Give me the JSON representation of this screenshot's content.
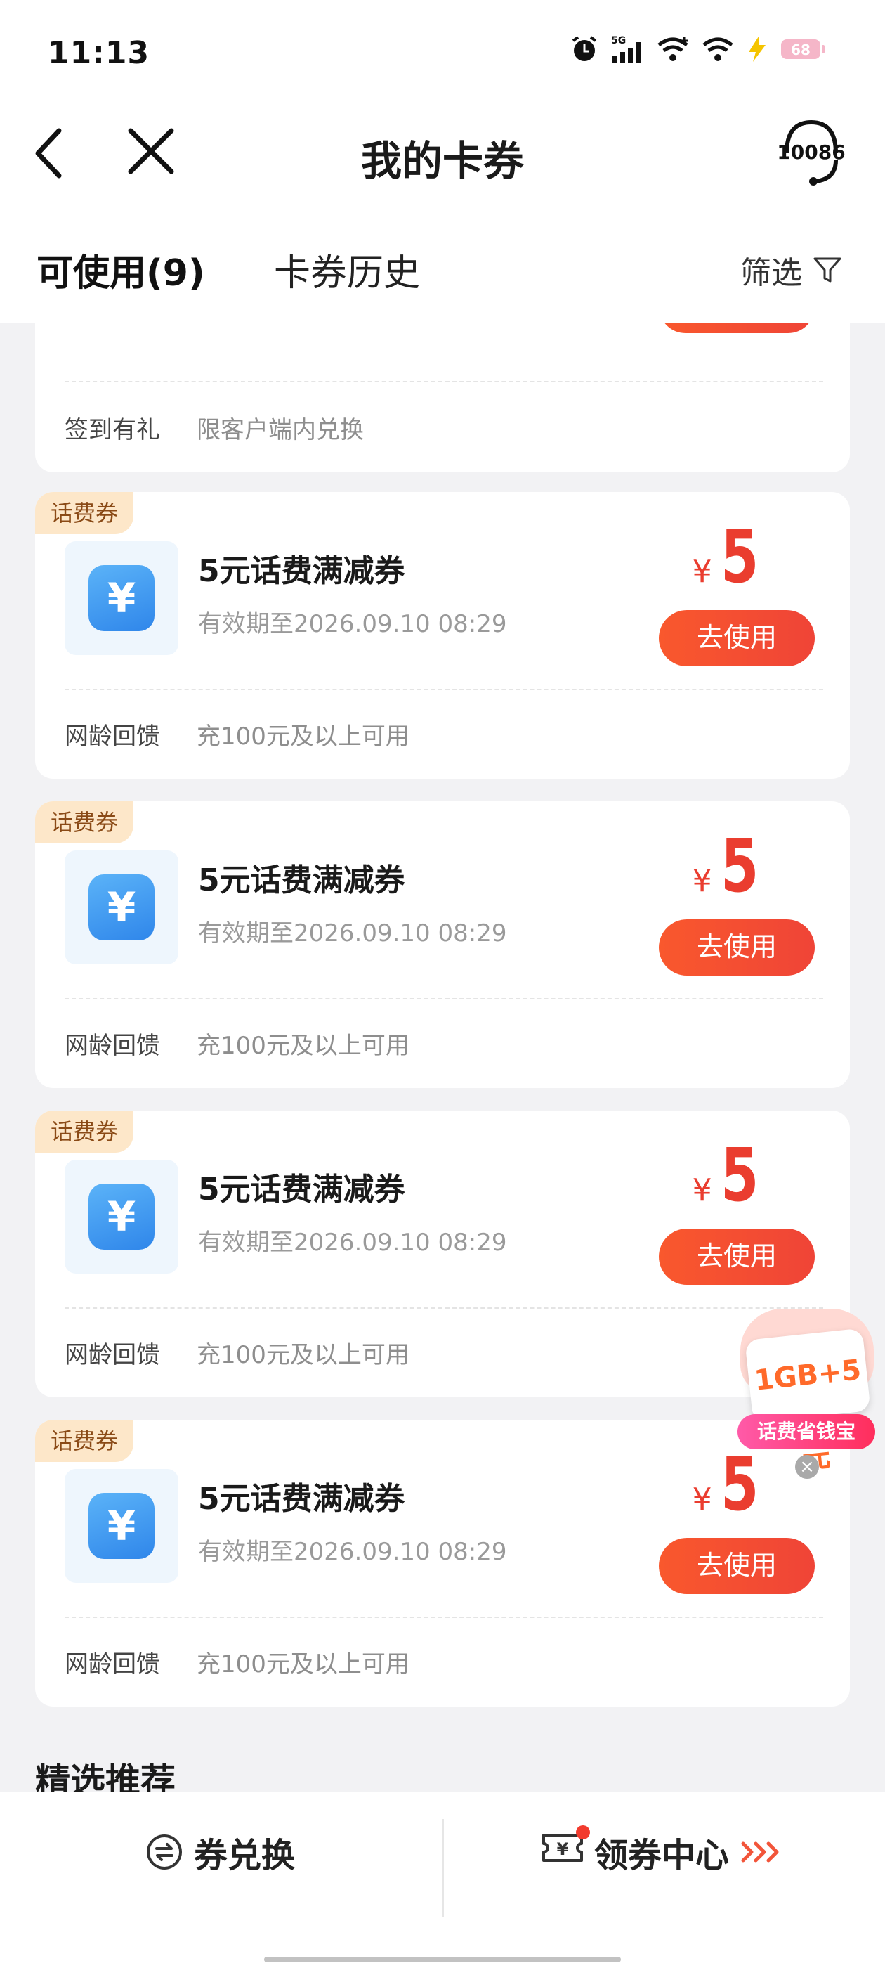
{
  "status": {
    "time": "11:13",
    "network": "5G",
    "battery": "68",
    "icons": [
      "alarm-icon",
      "signal-icon",
      "wifi-plus-icon",
      "wifi-icon",
      "charging-icon",
      "battery-icon"
    ]
  },
  "nav": {
    "title": "我的卡券",
    "service_number": "10086"
  },
  "tabs": {
    "available": "可使用(9)",
    "history": "卡券历史",
    "filter": "筛选"
  },
  "partial_card": {
    "button": "去使用",
    "footer_name": "签到有礼",
    "footer_desc": "限客户端内兑换"
  },
  "cards": [
    {
      "tag": "话费券",
      "title": "5元话费满减券",
      "validity": "有效期至2026.09.10 08:29",
      "currency": "¥",
      "amount": "5",
      "button": "去使用",
      "footer_name": "网龄回馈",
      "footer_desc": "充100元及以上可用"
    },
    {
      "tag": "话费券",
      "title": "5元话费满减券",
      "validity": "有效期至2026.09.10 08:29",
      "currency": "¥",
      "amount": "5",
      "button": "去使用",
      "footer_name": "网龄回馈",
      "footer_desc": "充100元及以上可用"
    },
    {
      "tag": "话费券",
      "title": "5元话费满减券",
      "validity": "有效期至2026.09.10 08:29",
      "currency": "¥",
      "amount": "5",
      "button": "去使用",
      "footer_name": "网龄回馈",
      "footer_desc": "充100元及以上可用"
    },
    {
      "tag": "话费券",
      "title": "5元话费满减券",
      "validity": "有效期至2026.09.10 08:29",
      "currency": "¥",
      "amount": "5",
      "button": "去使用",
      "footer_name": "网龄回馈",
      "footer_desc": "充100元及以上可用"
    }
  ],
  "icon_glyph": "¥",
  "section_title": "精选推荐",
  "promo": {
    "card_text": "1GB+5元",
    "label": "话费省钱宝",
    "close": "×"
  },
  "bottom": {
    "exchange_label": "券兑换",
    "center_label": "领券中心"
  },
  "colors": {
    "accent": "#ef4437",
    "price": "#ea3d2f",
    "tag_bg": "#fde7c9",
    "icon_blue": "#2f86ea"
  }
}
